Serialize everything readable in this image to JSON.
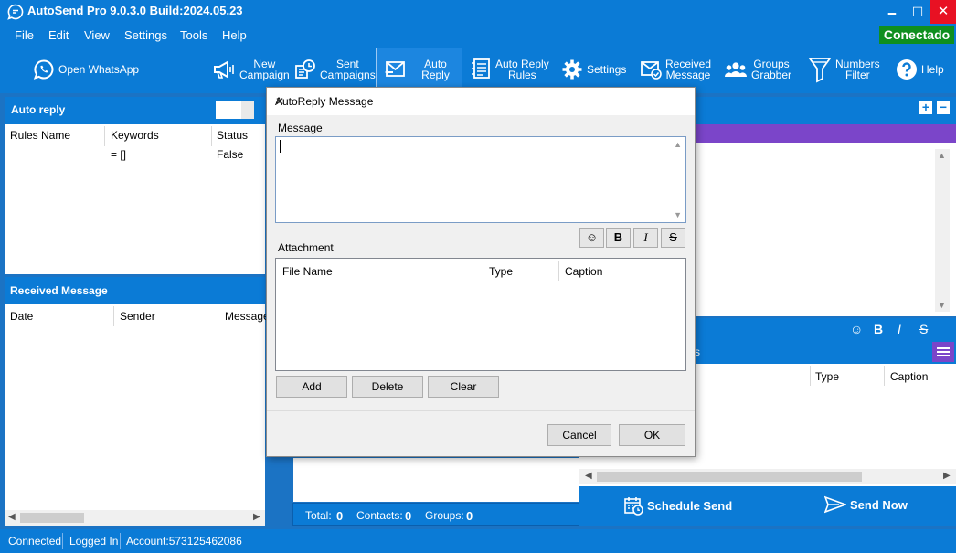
{
  "window": {
    "title": "AutoSend Pro 9.0.3.0 Build:2024.05.23",
    "minimize": "🗕",
    "maximize": "☐",
    "close": "✕"
  },
  "menu": [
    "File",
    "Edit",
    "View",
    "Settings",
    "Tools",
    "Help"
  ],
  "connection_badge": "Conectado",
  "toolbar": {
    "open_whatsapp": "Open WhatsApp",
    "new_campaign_1": "New",
    "new_campaign_2": "Campaign",
    "sent_campaigns_1": "Sent",
    "sent_campaigns_2": "Campaigns",
    "auto_reply": "Auto Reply",
    "auto_reply_rules_1": "Auto Reply",
    "auto_reply_rules_2": "Rules",
    "settings": "Settings",
    "received_message_1": "Received",
    "received_message_2": "Message",
    "groups_grabber_1": "Groups",
    "groups_grabber_2": "Grabber",
    "numbers_filter_1": "Numbers",
    "numbers_filter_2": "Filter",
    "help": "Help"
  },
  "auto_reply_panel": {
    "title": "Auto reply",
    "columns": [
      "Rules Name",
      "Keywords",
      "Status"
    ],
    "rows": [
      {
        "rules_name": "",
        "keywords": "= []",
        "status": "False"
      }
    ]
  },
  "received_panel": {
    "title": "Received Message",
    "columns": [
      "Date",
      "Sender",
      "Message"
    ]
  },
  "totals": {
    "total_label": "Total:",
    "total": "0",
    "contacts_label": "Contacts:",
    "contacts": "0",
    "groups_label": "Groups:",
    "groups": "0"
  },
  "right_panel": {
    "format": {
      "emoji": "☺",
      "bold": "B",
      "italic": "I",
      "strike": "S"
    },
    "attach_columns": [
      "Type",
      "Caption"
    ],
    "attach_header_partial": "s"
  },
  "send": {
    "schedule": "Schedule Send",
    "send_now": "Send Now"
  },
  "status": {
    "connected": "Connected",
    "logged_in": "Logged In",
    "account": "Account:573125462086"
  },
  "dialog": {
    "title": "AutoReply Message",
    "close": "✕",
    "message_label": "Message",
    "message_value": "",
    "format": {
      "emoji": "☺",
      "bold": "B",
      "italic": "I",
      "strike": "S"
    },
    "attachment_label": "Attachment",
    "attach_columns": [
      "File Name",
      "Type",
      "Caption"
    ],
    "add": "Add",
    "delete": "Delete",
    "clear": "Clear",
    "cancel": "Cancel",
    "ok": "OK"
  },
  "colors": {
    "primary": "#0b7bd6",
    "accent_purple": "#7b45c9",
    "connected_green": "#0f8f1f",
    "close_red": "#e81123"
  }
}
